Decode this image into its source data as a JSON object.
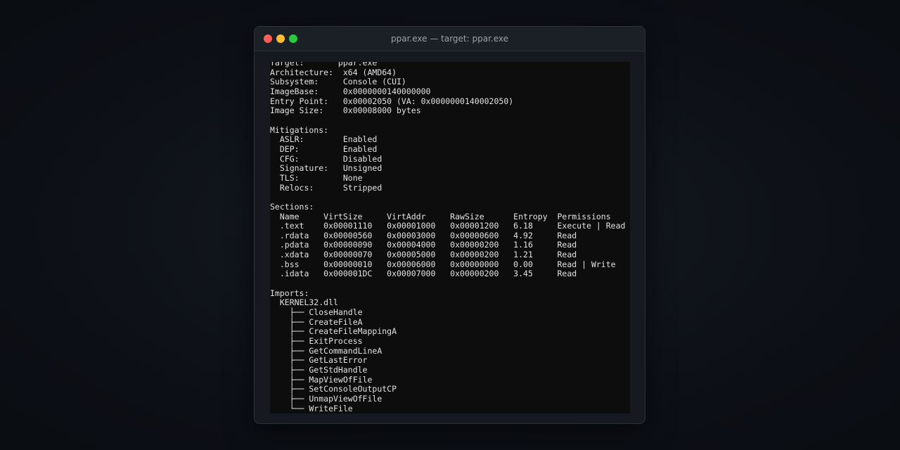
{
  "window": {
    "title": "ppar.exe — target: ppar.exe"
  },
  "colors": {
    "close": "#ff5f57",
    "minimize": "#febc2e",
    "maximize": "#28c840",
    "terminal_bg": "#0d0d0d",
    "terminal_fg": "#e2e2e2"
  },
  "terminal": {
    "output": "Target:       ppar.exe\nArchitecture:  x64 (AMD64)\nSubsystem:     Console (CUI)\nImageBase:     0x0000000140000000\nEntry Point:   0x00002050 (VA: 0x0000000140002050)\nImage Size:    0x00008000 bytes\n\nMitigations:\n  ASLR:        Enabled\n  DEP:         Enabled\n  CFG:         Disabled\n  Signature:   Unsigned\n  TLS:         None\n  Relocs:      Stripped\n\nSections:\n  Name     VirtSize     VirtAddr     RawSize      Entropy  Permissions\n  .text    0x00001110   0x00001000   0x00001200   6.18     Execute | Read\n  .rdata   0x00000560   0x00003000   0x00000600   4.92     Read\n  .pdata   0x00000090   0x00004000   0x00000200   1.16     Read\n  .xdata   0x00000070   0x00005000   0x00000200   1.21     Read\n  .bss     0x00000010   0x00006000   0x00000000   0.00     Read | Write\n  .idata   0x000001DC   0x00007000   0x00000200   3.45     Read\n\nImports:\n  KERNEL32.dll\n    ├── CloseHandle\n    ├── CreateFileA\n    ├── CreateFileMappingA\n    ├── ExitProcess\n    ├── GetCommandLineA\n    ├── GetLastError\n    ├── GetStdHandle\n    ├── MapViewOfFile\n    ├── SetConsoleOutputCP\n    ├── UnmapViewOfFile\n    └── WriteFile"
  }
}
